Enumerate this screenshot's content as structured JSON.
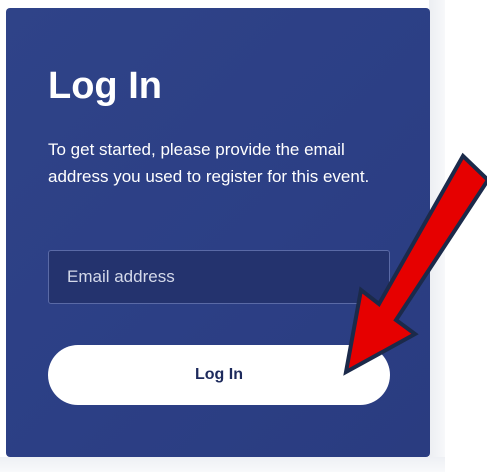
{
  "login_card": {
    "title": "Log In",
    "description": "To get started, please provide the email address you used to register for this event.",
    "email_field": {
      "placeholder": "Email address",
      "value": ""
    },
    "submit_label": "Log In"
  },
  "annotation": {
    "type": "arrow",
    "color": "#e60000",
    "outline_color": "#1b2a4a"
  }
}
